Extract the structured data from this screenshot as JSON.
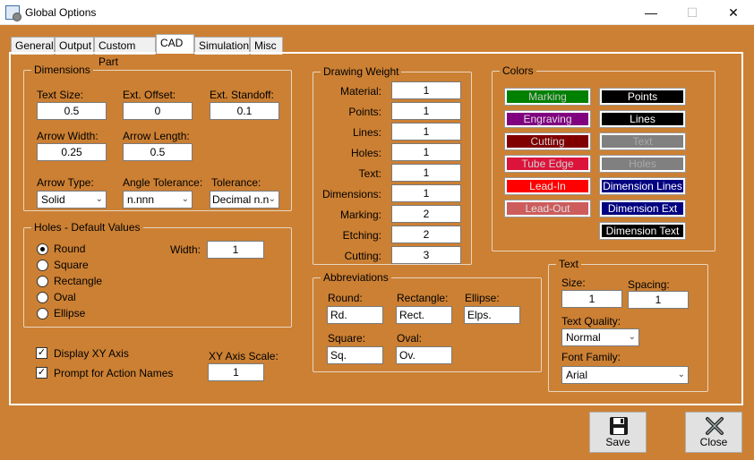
{
  "window": {
    "title": "Global Options",
    "min": "—",
    "max": "☐",
    "close": "✕"
  },
  "tabs": [
    "General",
    "Output",
    "Custom Part",
    "CAD",
    "Simulation",
    "Misc"
  ],
  "dimensions": {
    "title": "Dimensions",
    "text_size_label": "Text Size:",
    "text_size": "0.5",
    "ext_offset_label": "Ext. Offset:",
    "ext_offset": "0",
    "ext_standoff_label": "Ext. Standoff:",
    "ext_standoff": "0.1",
    "arrow_width_label": "Arrow Width:",
    "arrow_width": "0.25",
    "arrow_length_label": "Arrow Length:",
    "arrow_length": "0.5",
    "arrow_type_label": "Arrow Type:",
    "arrow_type": "Solid",
    "angle_tol_label": "Angle Tolerance:",
    "angle_tol": "n.nnn",
    "tolerance_label": "Tolerance:",
    "tolerance": "Decimal n.n"
  },
  "holes": {
    "title": "Holes - Default Values",
    "options": [
      "Round",
      "Square",
      "Rectangle",
      "Oval",
      "Ellipse"
    ],
    "selected": "Round",
    "width_label": "Width:",
    "width": "1"
  },
  "misc": {
    "display_xy": "Display XY Axis",
    "prompt_names": "Prompt for Action Names",
    "xy_scale_label": "XY Axis Scale:",
    "xy_scale": "1"
  },
  "drawing_weight": {
    "title": "Drawing Weight",
    "rows": [
      {
        "label": "Material:",
        "value": "1"
      },
      {
        "label": "Points:",
        "value": "1"
      },
      {
        "label": "Lines:",
        "value": "1"
      },
      {
        "label": "Holes:",
        "value": "1"
      },
      {
        "label": "Text:",
        "value": "1"
      },
      {
        "label": "Dimensions:",
        "value": "1"
      },
      {
        "label": "Marking:",
        "value": "2"
      },
      {
        "label": "Etching:",
        "value": "2"
      },
      {
        "label": "Cutting:",
        "value": "3"
      }
    ]
  },
  "abbreviations": {
    "title": "Abbreviations",
    "round_label": "Round:",
    "round": "Rd.",
    "rectangle_label": "Rectangle:",
    "rectangle": "Rect.",
    "ellipse_label": "Ellipse:",
    "ellipse": "Elps.",
    "square_label": "Square:",
    "square": "Sq.",
    "oval_label": "Oval:",
    "oval": "Ov."
  },
  "colors": {
    "title": "Colors",
    "left": [
      {
        "label": "Marking",
        "bg": "#008000",
        "fg": "#c8c8c8"
      },
      {
        "label": "Engraving",
        "bg": "#800080",
        "fg": "#e0e0e0"
      },
      {
        "label": "Cutting",
        "bg": "#800000",
        "fg": "#d0d0d0"
      },
      {
        "label": "Tube Edge",
        "bg": "#dc143c",
        "fg": "#d0d0d0"
      },
      {
        "label": "Lead-In",
        "bg": "#ff0000",
        "fg": "#e8e8e8"
      },
      {
        "label": "Lead-Out",
        "bg": "#cd5c5c",
        "fg": "#e0e0e0"
      }
    ],
    "right": [
      {
        "label": "Points",
        "bg": "#000000",
        "fg": "#ffffff"
      },
      {
        "label": "Lines",
        "bg": "#000000",
        "fg": "#ffffff"
      },
      {
        "label": "Text",
        "bg": "#808080",
        "fg": "#a9a9a9"
      },
      {
        "label": "Holes",
        "bg": "#808080",
        "fg": "#a9a9a9"
      },
      {
        "label": "Dimension Lines",
        "bg": "#000080",
        "fg": "#ffffff"
      },
      {
        "label": "Dimension Ext",
        "bg": "#000080",
        "fg": "#ffffff"
      },
      {
        "label": "Dimension Text",
        "bg": "#000000",
        "fg": "#ffffff"
      }
    ]
  },
  "text": {
    "title": "Text",
    "size_label": "Size:",
    "size": "1",
    "spacing_label": "Spacing:",
    "spacing": "1",
    "quality_label": "Text Quality:",
    "quality": "Normal",
    "font_label": "Font Family:",
    "font": "Arial"
  },
  "buttons": {
    "save": "Save",
    "close": "Close"
  },
  "theme": {
    "background": "#cc8033"
  }
}
